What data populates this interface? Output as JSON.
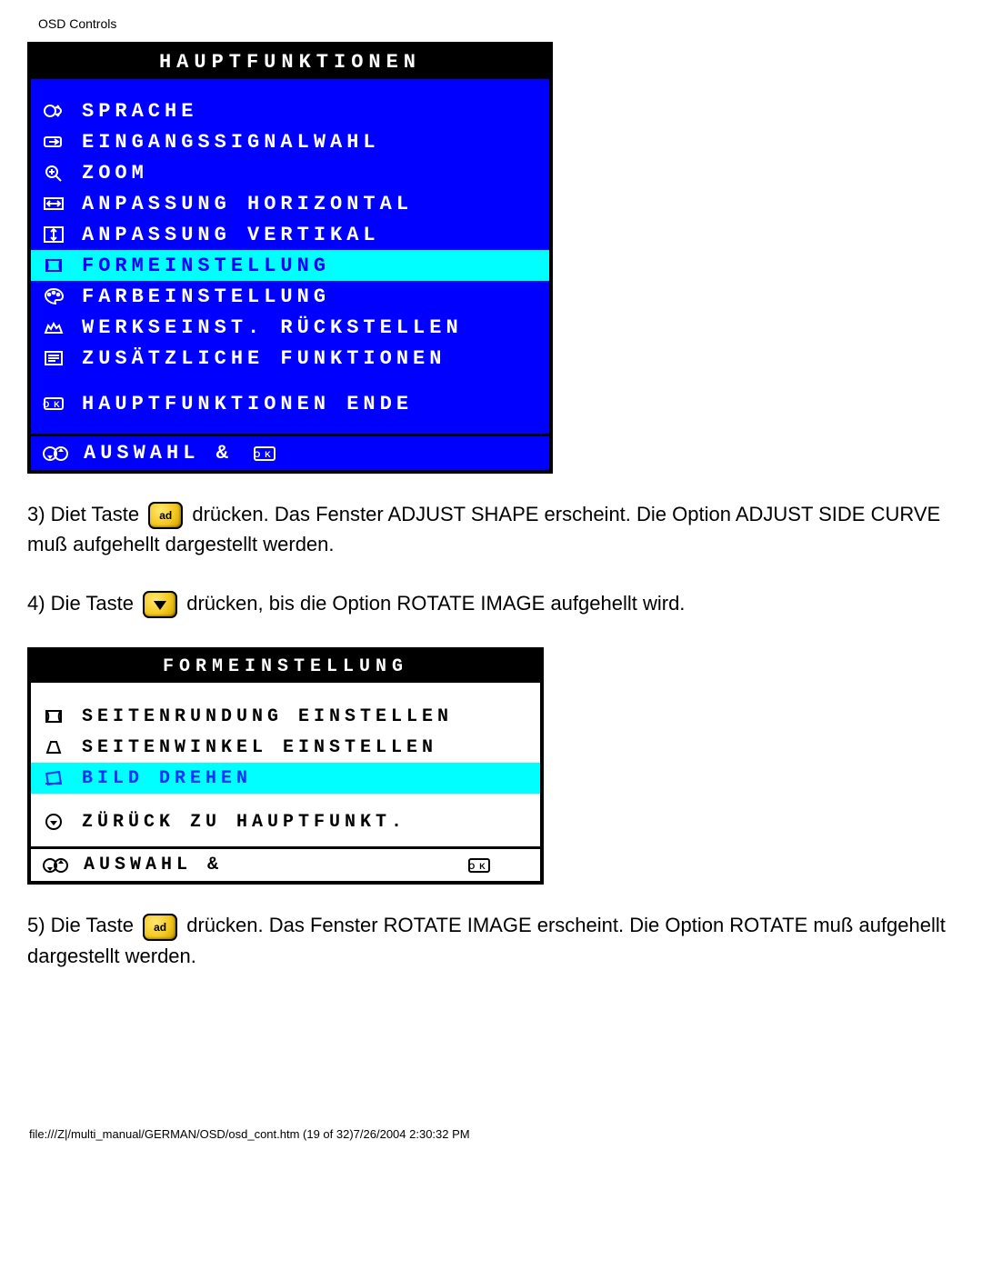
{
  "page": {
    "header": "OSD Controls",
    "footer": "file:///Z|/multi_manual/GERMAN/OSD/osd_cont.htm (19 of 32)7/26/2004 2:30:32 PM"
  },
  "osd1": {
    "title": "HAUPTFUNKTIONEN",
    "items": [
      {
        "label": "SPRACHE"
      },
      {
        "label": "EINGANGSSIGNALWAHL"
      },
      {
        "label": "ZOOM"
      },
      {
        "label": "ANPASSUNG HORIZONTAL"
      },
      {
        "label": "ANPASSUNG VERTIKAL"
      },
      {
        "label": "FORMEINSTELLUNG"
      },
      {
        "label": "FARBEINSTELLUNG"
      },
      {
        "label": "WERKSEINST. RÜCKSTELLEN"
      },
      {
        "label": "ZUSÄTZLICHE FUNKTIONEN"
      }
    ],
    "selected_index": 5,
    "exit": "HAUPTFUNKTIONEN ENDE",
    "footer": "AUSWAHL &"
  },
  "instr3": {
    "before": "3) Diet Taste ",
    "after": " drücken. Das Fenster ADJUST SHAPE erscheint. Die Option ADJUST SIDE CURVE muß aufgehellt dargestellt werden."
  },
  "instr4": {
    "before": "4) Die Taste ",
    "after": " drücken, bis die Option ROTATE IMAGE aufgehellt wird."
  },
  "osd2": {
    "title": "FORMEINSTELLUNG",
    "items": [
      {
        "label": "SEITENRUNDUNG EINSTELLEN"
      },
      {
        "label": "SEITENWINKEL EINSTELLEN"
      },
      {
        "label": "BILD DREHEN"
      }
    ],
    "selected_index": 2,
    "back": "ZÜRÜCK ZU HAUPTFUNKT.",
    "footer": "AUSWAHL &"
  },
  "instr5": {
    "before": "5) Die Taste ",
    "after": " drücken. Das Fenster ROTATE IMAGE erscheint. Die Option ROTATE muß aufgehellt dargestellt werden."
  },
  "buttons": {
    "ok": "ad"
  }
}
